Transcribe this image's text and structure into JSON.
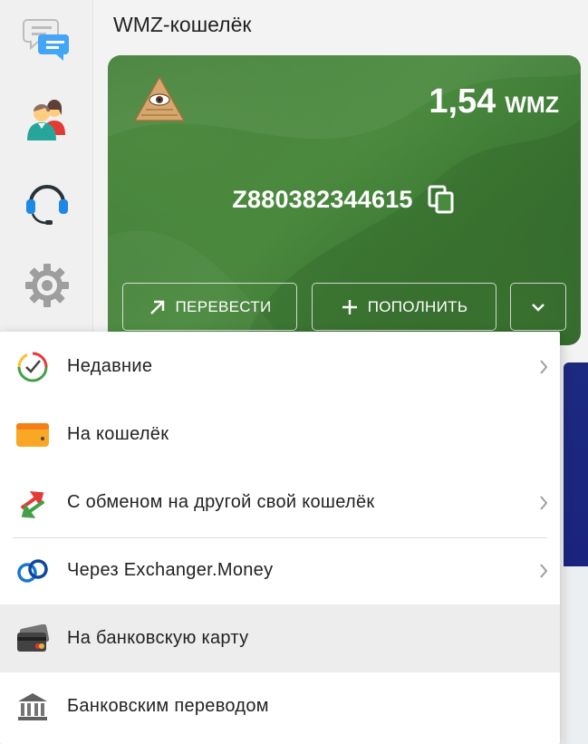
{
  "page": {
    "title": "WMZ-кошелёк"
  },
  "wallet": {
    "balance_amount": "1,54",
    "balance_currency": "WMZ",
    "number": "Z880382344615"
  },
  "actions": {
    "transfer_label": "ПЕРЕВЕСТИ",
    "topup_label": "ПОПОЛНИТЬ"
  },
  "rail": {
    "icons": [
      "chat-icon",
      "contacts-icon",
      "support-headset-icon",
      "settings-gear-icon"
    ]
  },
  "menu": {
    "items": [
      {
        "label": "Недавние",
        "icon": "recent-clock-icon",
        "has_submenu": true
      },
      {
        "label": "На кошелёк",
        "icon": "wallet-icon",
        "has_submenu": false
      },
      {
        "label": "С обменом на другой свой кошелёк",
        "icon": "exchange-arrows-icon",
        "has_submenu": true
      },
      {
        "label": "Через Exchanger.Money",
        "icon": "exchanger-link-icon",
        "has_submenu": true
      },
      {
        "label": "На банковскую карту",
        "icon": "bank-card-icon",
        "has_submenu": false
      },
      {
        "label": "Банковским переводом",
        "icon": "bank-building-icon",
        "has_submenu": false
      }
    ]
  },
  "colors": {
    "card_green": "#3f7a35",
    "menu_hover": "#ededed",
    "accent_blue": "#1a237e"
  }
}
